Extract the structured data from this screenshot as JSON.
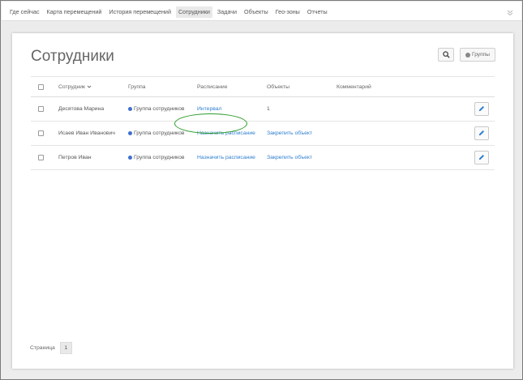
{
  "nav": {
    "items": [
      {
        "label": "Где сейчас",
        "active": false
      },
      {
        "label": "Карта перемещений",
        "active": false
      },
      {
        "label": "История перемещений",
        "active": false
      },
      {
        "label": "Сотрудники",
        "active": true
      },
      {
        "label": "Задачи",
        "active": false
      },
      {
        "label": "Объекты",
        "active": false
      },
      {
        "label": "Гео-зоны",
        "active": false
      },
      {
        "label": "Отчеты",
        "active": false
      }
    ],
    "menu_icon": "chevron-down-icon"
  },
  "page": {
    "title": "Сотрудники",
    "search_icon": "search-icon",
    "groups_button": "Группы"
  },
  "table": {
    "headers": {
      "name": "Сотрудник",
      "group": "Группа",
      "schedule": "Расписание",
      "objects": "Объекты",
      "comment": "Комментарий"
    },
    "rows": [
      {
        "name": "Десятова Марина",
        "group": "Группа сотрудников",
        "schedule": "Интервал",
        "objects": "1",
        "comment": ""
      },
      {
        "name": "Исаев Иван Иванович",
        "group": "Группа сотрудников",
        "schedule": "Назначить расписание",
        "objects": "Закрепить объект",
        "comment": ""
      },
      {
        "name": "Петров Иван",
        "group": "Группа сотрудников",
        "schedule": "Назначить расписание",
        "objects": "Закрепить объект",
        "comment": ""
      }
    ]
  },
  "pagination": {
    "label": "Страница",
    "page": "1"
  },
  "colors": {
    "link": "#2f7fd0",
    "group_dot": "#3f6fd1",
    "highlight": "#2c9b2c"
  }
}
